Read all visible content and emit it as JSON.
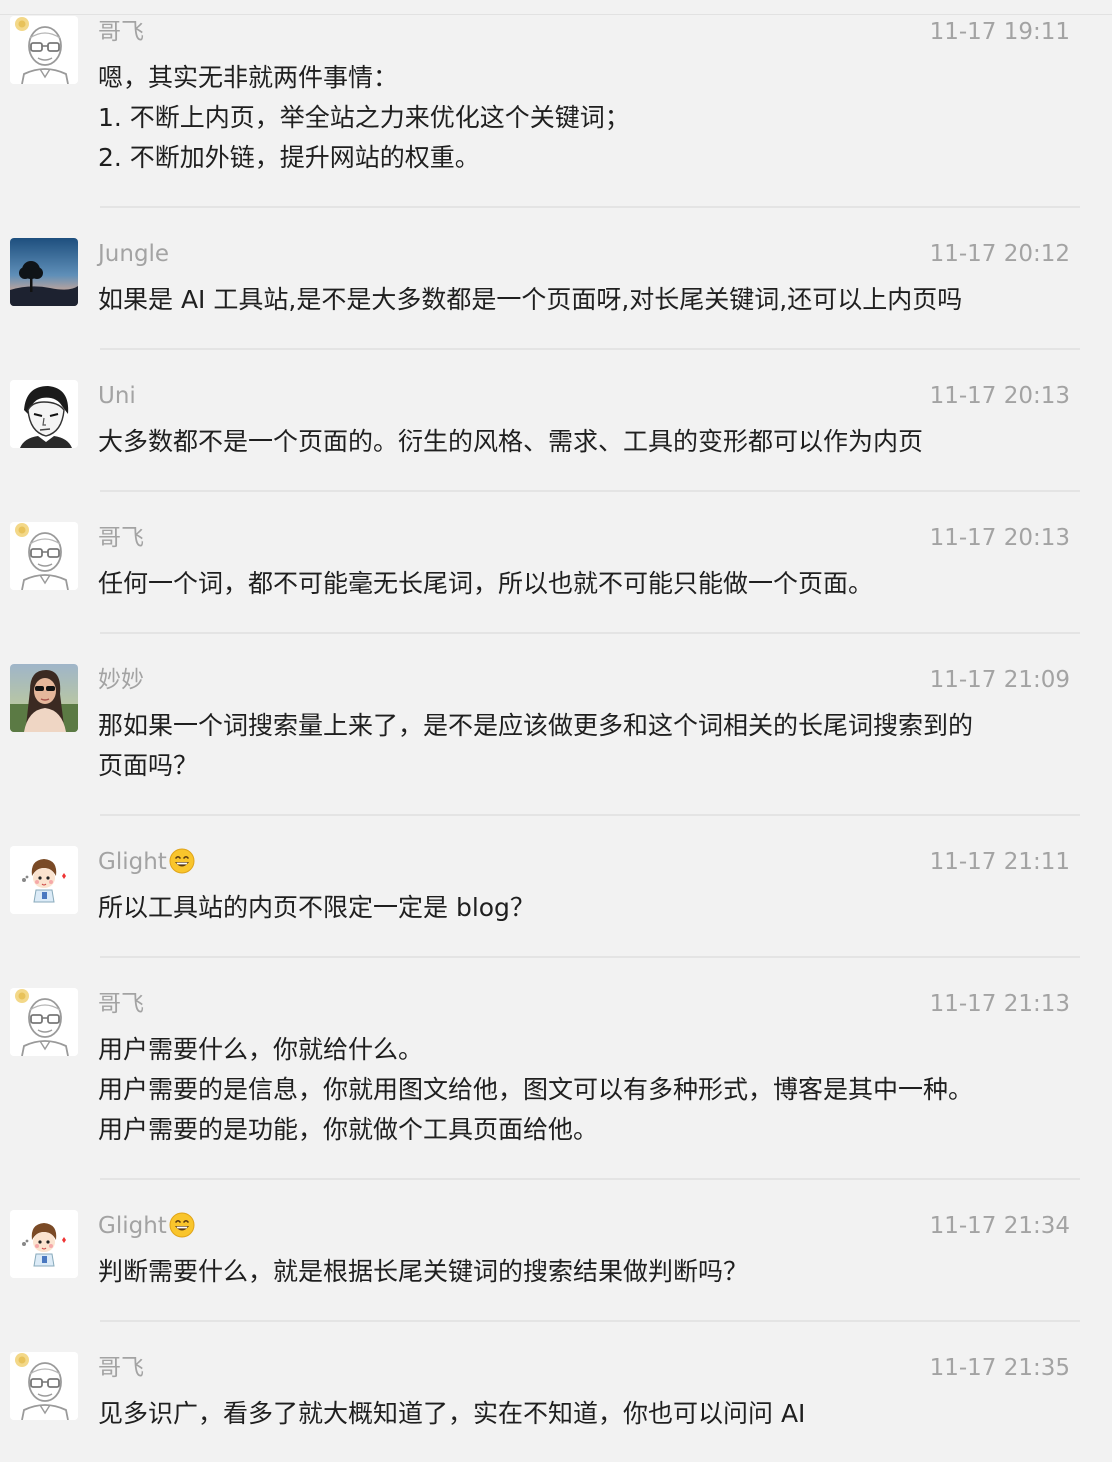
{
  "messages": [
    {
      "avatar": "bald-glasses-man-avatar",
      "name": "哥飞",
      "name_emoji": "",
      "time": "11-17 19:11",
      "lines": [
        "嗯，其实无非就两件事情：",
        "1. 不断上内页，举全站之力来优化这个关键词；",
        "2. 不断加外链，提升网站的权重。"
      ]
    },
    {
      "avatar": "sunset-tree-avatar",
      "name": "Jungle",
      "name_emoji": "",
      "time": "11-17 20:12",
      "lines": [
        "如果是 AI 工具站,是不是大多数都是一个页面呀,对长尾关键词,还可以上内页吗"
      ]
    },
    {
      "avatar": "anime-man-sketch-avatar",
      "name": "Uni",
      "name_emoji": "",
      "time": "11-17 20:13",
      "lines": [
        "大多数都不是一个页面的。衍生的风格、需求、工具的变形都可以作为内页"
      ]
    },
    {
      "avatar": "bald-glasses-man-avatar",
      "name": "哥飞",
      "name_emoji": "",
      "time": "11-17 20:13",
      "lines": [
        "任何一个词，都不可能毫无长尾词，所以也就不可能只能做一个页面。"
      ]
    },
    {
      "avatar": "woman-sunglasses-photo-avatar",
      "name": "妙妙",
      "name_emoji": "",
      "time": "11-17 21:09",
      "lines": [
        "那如果一个词搜索量上来了，是不是应该做更多和这个词相关的长尾词搜索到的",
        "页面吗？"
      ]
    },
    {
      "avatar": "cartoon-boy-avatar",
      "name": "Glight",
      "name_emoji": "grinning-face-emoji",
      "time": "11-17 21:11",
      "lines": [
        "所以工具站的内页不限定一定是 blog？"
      ]
    },
    {
      "avatar": "bald-glasses-man-avatar",
      "name": "哥飞",
      "name_emoji": "",
      "time": "11-17 21:13",
      "lines": [
        "用户需要什么，你就给什么。",
        "用户需要的是信息，你就用图文给他，图文可以有多种形式，博客是其中一种。",
        "用户需要的是功能，你就做个工具页面给他。"
      ]
    },
    {
      "avatar": "cartoon-boy-avatar",
      "name": "Glight",
      "name_emoji": "grinning-face-emoji",
      "time": "11-17 21:34",
      "lines": [
        "判断需要什么，就是根据长尾关键词的搜索结果做判断吗？"
      ]
    },
    {
      "avatar": "bald-glasses-man-avatar",
      "name": "哥飞",
      "name_emoji": "",
      "time": "11-17 21:35",
      "lines": [
        "见多识广，看多了就大概知道了，实在不知道，你也可以问问 AI"
      ]
    }
  ],
  "colors": {
    "background": "#f2f2f2",
    "name_and_time": "#a3a3a3",
    "message_text": "#1f1f1f",
    "separator": "#e4e4e4"
  }
}
